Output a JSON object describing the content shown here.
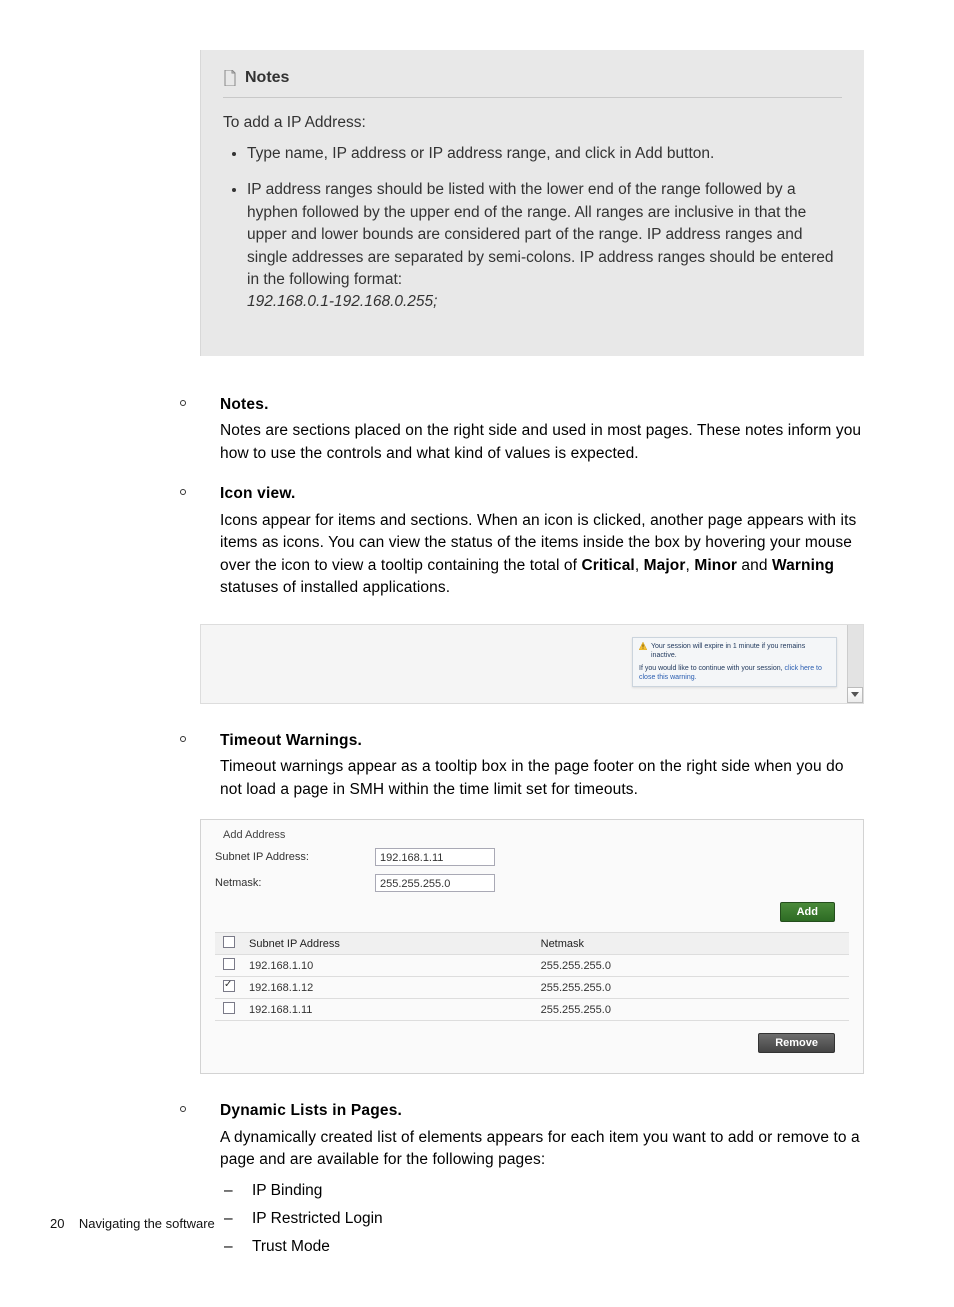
{
  "notes_box": {
    "title": "Notes",
    "intro": "To add a IP Address:",
    "bullets": [
      "Type name, IP address or IP address range, and click in Add button.",
      "IP address ranges should be listed with the lower end of the range followed by a hyphen followed by the upper end of the range. All ranges are inclusive in that the upper and lower bounds are considered part of the range. IP address ranges and single addresses are separated by semi-colons. IP address ranges should be entered in the following format:"
    ],
    "example": "192.168.0.1-192.168.0.255;"
  },
  "sections": {
    "notes": {
      "title": "Notes.",
      "desc": "Notes are sections placed on the right side and used in most pages. These notes inform you how to use the controls and what kind of values is expected."
    },
    "iconview": {
      "title": "Icon view.",
      "desc_pre": "Icons appear for items and sections. When an icon is clicked, another page appears with its items as icons. You can view the status of the items inside the box by hovering your mouse over the icon to view a tooltip containing the total of ",
      "bold1": "Critical",
      "mid1": ", ",
      "bold2": "Major",
      "mid2": ", ",
      "bold3": "Minor",
      "mid3": " and ",
      "bold4": "Warning",
      "desc_post": " statuses of installed applications."
    },
    "timeout": {
      "title": "Timeout Warnings.",
      "desc": "Timeout warnings appear as a tooltip box in the page footer on the right side when you do not load a page in SMH within the time limit set for timeouts."
    },
    "dynamic": {
      "title": "Dynamic Lists in Pages.",
      "desc": "A dynamically created list of elements appears for each item you want to add or remove to a page and are available for the following pages:",
      "items": [
        "IP Binding",
        "IP Restricted Login",
        "Trust Mode"
      ]
    }
  },
  "timeout_figure": {
    "warn_text": "Your session will expire in 1 minute if you remains inactive.",
    "link_pre": "If you would like to continue with your session, ",
    "link_text": "click here to close this warning."
  },
  "add_address": {
    "legend": "Add Address",
    "labels": {
      "subnet": "Subnet IP Address:",
      "netmask": "Netmask:"
    },
    "values": {
      "subnet": "192.168.1.11",
      "netmask": "255.255.255.0"
    },
    "add_button": "Add",
    "remove_button": "Remove",
    "columns": {
      "ip": "Subnet IP Address",
      "mask": "Netmask"
    },
    "rows": [
      {
        "checked": false,
        "ip": "192.168.1.10",
        "mask": "255.255.255.0"
      },
      {
        "checked": true,
        "ip": "192.168.1.12",
        "mask": "255.255.255.0"
      },
      {
        "checked": false,
        "ip": "192.168.1.11",
        "mask": "255.255.255.0"
      }
    ]
  },
  "footer": {
    "page_number": "20",
    "section": "Navigating the software"
  }
}
